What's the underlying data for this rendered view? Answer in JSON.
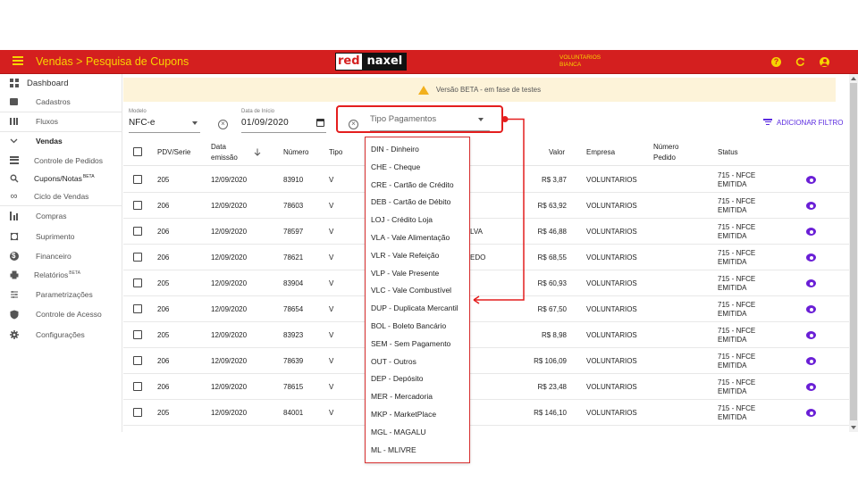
{
  "topbar": {
    "page_title": "Vendas > Pesquisa de Cupons",
    "logo_red": "red",
    "logo_naxel": "naxel",
    "user_line1": "VOLUNTARIOS",
    "user_line2": "BIANCA",
    "help_glyph": "?",
    "colors": {
      "bar": "#d41f1f",
      "accent": "#f7d400"
    }
  },
  "sidebar": {
    "items": [
      {
        "label": "Dashboard",
        "icon": "dashboard-icon"
      },
      {
        "label": "Cadastros",
        "icon": "folder-icon"
      },
      {
        "label": "Fluxos",
        "icon": "columns-icon"
      },
      {
        "label": "Vendas",
        "icon": "chevron-down-icon"
      },
      {
        "label": "Controle de Pedidos",
        "icon": "list-icon"
      },
      {
        "label": "Cupons/Notas",
        "sup": "BETA",
        "icon": "search-receipt-icon"
      },
      {
        "label": "Ciclo de Vendas",
        "icon": "infinity-icon"
      },
      {
        "label": "Compras",
        "icon": "purchase-icon"
      },
      {
        "label": "Suprimento",
        "icon": "box-icon"
      },
      {
        "label": "Financeiro",
        "icon": "money-icon"
      },
      {
        "label": "Relatórios",
        "sup": "BETA",
        "icon": "print-icon"
      },
      {
        "label": "Parametrizações",
        "icon": "settings-grid-icon"
      },
      {
        "label": "Controle de Acesso",
        "icon": "shield-icon"
      },
      {
        "label": "Configurações",
        "icon": "gear-icon"
      }
    ]
  },
  "banner": {
    "text": "Versão BETA - em fase de testes"
  },
  "filters": {
    "modelo_label": "Modelo",
    "modelo_value": "NFC-e",
    "data_label": "Data de Início",
    "data_value": "01/09/2020",
    "tipo_placeholder": "Tipo Pagamentos",
    "add_filter": "ADICIONAR FILTRO"
  },
  "table": {
    "headers": {
      "pdv": "PDV/Serie",
      "data_line1": "Data",
      "data_line2": "emissão",
      "numero": "Número",
      "tipo": "Tipo",
      "valor": "Valor",
      "empresa": "Empresa",
      "pedido_line1": "Número",
      "pedido_line2": "Pedido",
      "status": "Status"
    },
    "rows": [
      {
        "pdv": "205",
        "data": "12/09/2020",
        "numero": "83910",
        "tipo": "V",
        "extra": "",
        "valor": "R$ 3,87",
        "empresa": "VOLUNTARIOS",
        "status1": "715 - NFCE",
        "status2": "EMITIDA"
      },
      {
        "pdv": "206",
        "data": "12/09/2020",
        "numero": "78603",
        "tipo": "V",
        "extra": "",
        "valor": "R$ 63,92",
        "empresa": "VOLUNTARIOS",
        "status1": "715 - NFCE",
        "status2": "EMITIDA"
      },
      {
        "pdv": "206",
        "data": "12/09/2020",
        "numero": "78597",
        "tipo": "V",
        "extra": "LVA",
        "valor": "R$ 46,88",
        "empresa": "VOLUNTARIOS",
        "status1": "715 - NFCE",
        "status2": "EMITIDA"
      },
      {
        "pdv": "206",
        "data": "12/09/2020",
        "numero": "78621",
        "tipo": "V",
        "extra": "EDO",
        "valor": "R$ 68,55",
        "empresa": "VOLUNTARIOS",
        "status1": "715 - NFCE",
        "status2": "EMITIDA"
      },
      {
        "pdv": "205",
        "data": "12/09/2020",
        "numero": "83904",
        "tipo": "V",
        "extra": "",
        "valor": "R$ 60,93",
        "empresa": "VOLUNTARIOS",
        "status1": "715 - NFCE",
        "status2": "EMITIDA"
      },
      {
        "pdv": "206",
        "data": "12/09/2020",
        "numero": "78654",
        "tipo": "V",
        "extra": "",
        "valor": "R$ 67,50",
        "empresa": "VOLUNTARIOS",
        "status1": "715 - NFCE",
        "status2": "EMITIDA"
      },
      {
        "pdv": "205",
        "data": "12/09/2020",
        "numero": "83923",
        "tipo": "V",
        "extra": "",
        "valor": "R$ 8,98",
        "empresa": "VOLUNTARIOS",
        "status1": "715 - NFCE",
        "status2": "EMITIDA"
      },
      {
        "pdv": "206",
        "data": "12/09/2020",
        "numero": "78639",
        "tipo": "V",
        "extra": "",
        "valor": "R$ 106,09",
        "empresa": "VOLUNTARIOS",
        "status1": "715 - NFCE",
        "status2": "EMITIDA"
      },
      {
        "pdv": "206",
        "data": "12/09/2020",
        "numero": "78615",
        "tipo": "V",
        "extra": "",
        "valor": "R$ 23,48",
        "empresa": "VOLUNTARIOS",
        "status1": "715 - NFCE",
        "status2": "EMITIDA"
      },
      {
        "pdv": "205",
        "data": "12/09/2020",
        "numero": "84001",
        "tipo": "V",
        "extra": "",
        "valor": "R$ 146,10",
        "empresa": "VOLUNTARIOS",
        "status1": "715 - NFCE",
        "status2": "EMITIDA"
      }
    ]
  },
  "dropdown": {
    "options": [
      "DIN - Dinheiro",
      "CHE - Cheque",
      "CRE - Cartão de Crédito",
      "DEB - Cartão de Débito",
      "LOJ - Crédito Loja",
      "VLA - Vale Alimentação",
      "VLR - Vale Refeição",
      "VLP - Vale Presente",
      "VLC - Vale Combustível",
      "DUP - Duplicata Mercantil",
      "BOL - Boleto Bancário",
      "SEM - Sem Pagamento",
      "OUT - Outros",
      "DEP - Depósito",
      "MER - Mercadoria",
      "MKP - MarketPlace",
      "MGL - MAGALU",
      "ML - MLIVRE"
    ],
    "highlight_color": "#e41e1e"
  }
}
